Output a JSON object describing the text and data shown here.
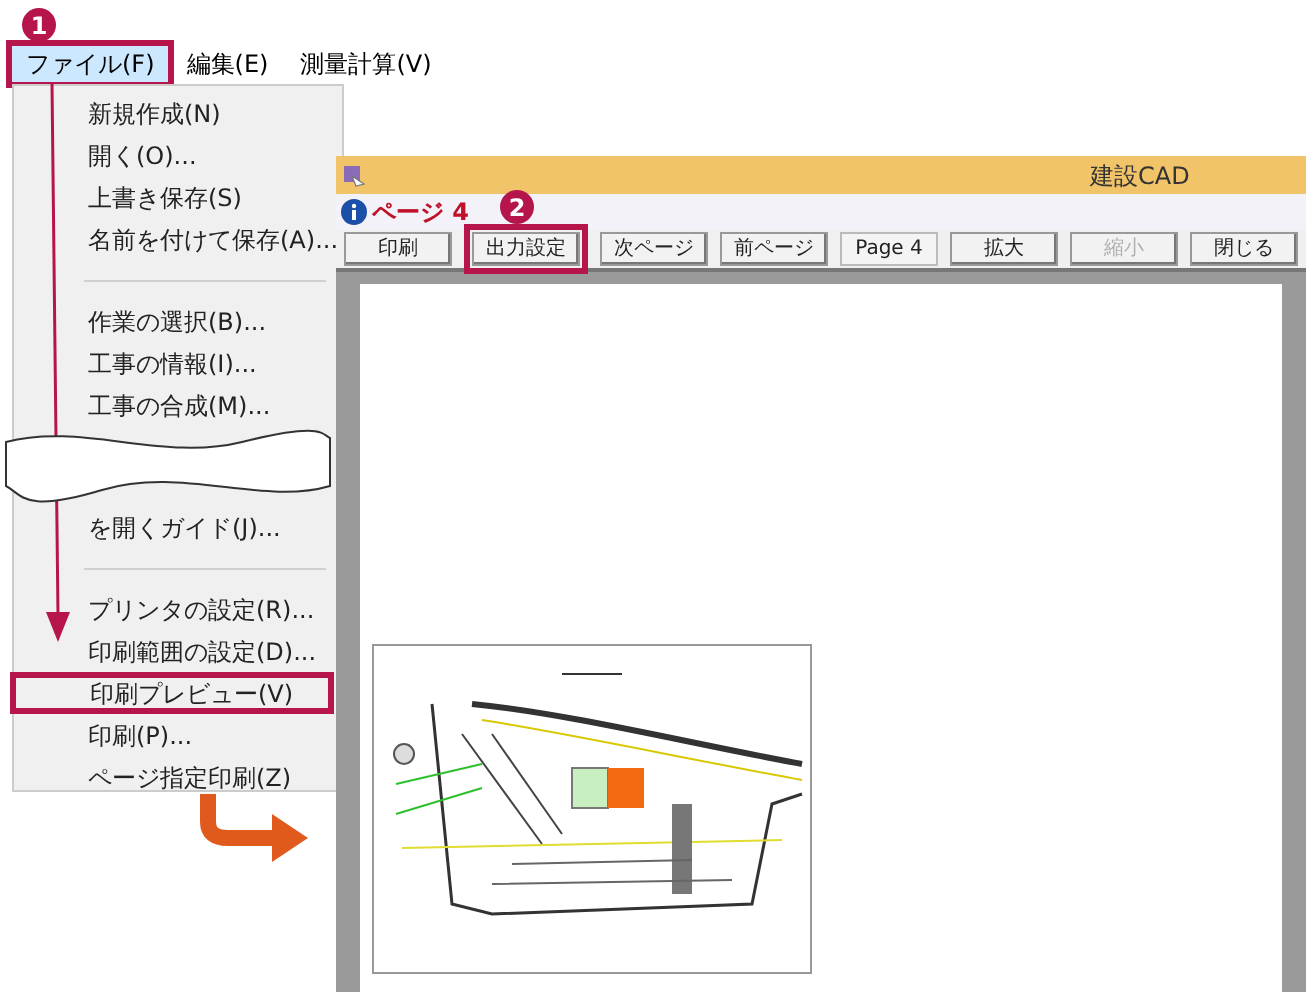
{
  "steps": [
    {
      "number": "1"
    },
    {
      "number": "2"
    }
  ],
  "menu_bar": [
    {
      "label": "ファイル(F)",
      "selected": true
    },
    {
      "label": "編集(E)",
      "selected": false
    },
    {
      "label": "測量計算(V)",
      "selected": false
    }
  ],
  "file_menu": [
    {
      "kind": "item",
      "label": "新規作成(N)",
      "highlighted": false
    },
    {
      "kind": "item",
      "label": "開く(O)...",
      "highlighted": false
    },
    {
      "kind": "item",
      "label": "上書き保存(S)",
      "highlighted": false
    },
    {
      "kind": "item",
      "label": "名前を付けて保存(A)...",
      "highlighted": false
    },
    {
      "kind": "separator"
    },
    {
      "kind": "item",
      "label": "作業の選択(B)...",
      "highlighted": false
    },
    {
      "kind": "item",
      "label": "工事の情報(I)...",
      "highlighted": false
    },
    {
      "kind": "item",
      "label": "工事の合成(M)...",
      "highlighted": false
    },
    {
      "kind": "break"
    },
    {
      "kind": "item",
      "label": "を開くガイド(J)...",
      "highlighted": false
    },
    {
      "kind": "separator"
    },
    {
      "kind": "item",
      "label": "プリンタの設定(R)...",
      "highlighted": false
    },
    {
      "kind": "item",
      "label": "印刷範囲の設定(D)...",
      "highlighted": false
    },
    {
      "kind": "item",
      "label": "印刷プレビュー(V)",
      "highlighted": true
    },
    {
      "kind": "item",
      "label": "印刷(P)...",
      "highlighted": false
    },
    {
      "kind": "item",
      "label": "ページ指定印刷(Z)",
      "highlighted": false
    }
  ],
  "window": {
    "title": "建設CAD",
    "page_label": "ページ 4",
    "toolbar": [
      {
        "kind": "button",
        "label": "印刷",
        "disabled": false,
        "highlighted": false
      },
      {
        "kind": "button",
        "label": "出力設定",
        "disabled": false,
        "highlighted": true
      },
      {
        "kind": "button",
        "label": "次ページ",
        "disabled": false,
        "highlighted": false
      },
      {
        "kind": "button",
        "label": "前ページ",
        "disabled": false,
        "highlighted": false
      },
      {
        "kind": "field",
        "value": "Page 4"
      },
      {
        "kind": "button",
        "label": "拡大",
        "disabled": false,
        "highlighted": false
      },
      {
        "kind": "button",
        "label": "縮小",
        "disabled": true,
        "highlighted": false
      },
      {
        "kind": "button",
        "label": "閉じる",
        "disabled": false,
        "highlighted": false
      }
    ]
  }
}
